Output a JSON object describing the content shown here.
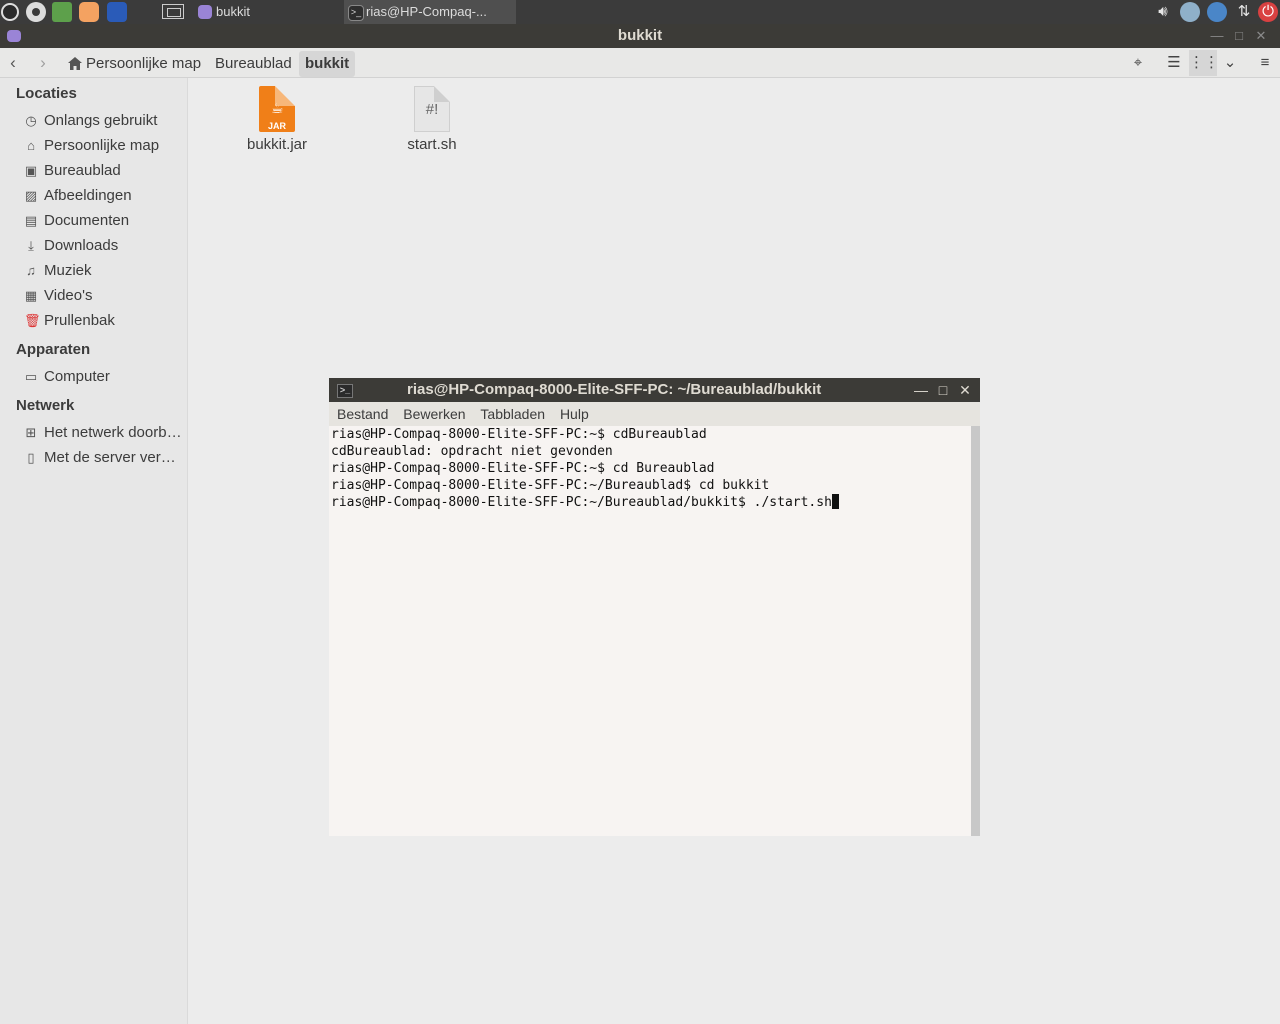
{
  "top_panel": {
    "tasks": [
      {
        "label": "bukkit"
      },
      {
        "label": "rias@HP-Compaq-..."
      }
    ]
  },
  "window": {
    "title": "bukkit"
  },
  "toolbar": {
    "breadcrumbs": [
      "Persoonlijke map",
      "Bureaublad",
      "bukkit"
    ]
  },
  "sidebar": {
    "sections": [
      {
        "heading": "Locaties",
        "items": [
          {
            "label": "Onlangs gebruikt",
            "icon": "clock-icon"
          },
          {
            "label": "Persoonlijke map",
            "icon": "home-icon"
          },
          {
            "label": "Bureaublad",
            "icon": "desktop-icon"
          },
          {
            "label": "Afbeeldingen",
            "icon": "image-icon"
          },
          {
            "label": "Documenten",
            "icon": "document-icon"
          },
          {
            "label": "Downloads",
            "icon": "download-icon"
          },
          {
            "label": "Muziek",
            "icon": "music-icon"
          },
          {
            "label": "Video's",
            "icon": "video-icon"
          },
          {
            "label": "Prullenbak",
            "icon": "trash-icon"
          }
        ]
      },
      {
        "heading": "Apparaten",
        "items": [
          {
            "label": "Computer",
            "icon": "computer-icon"
          }
        ]
      },
      {
        "heading": "Netwerk",
        "items": [
          {
            "label": "Het netwerk doorbladeren",
            "icon": "network-icon"
          },
          {
            "label": "Met de server verbinden",
            "icon": "server-icon"
          }
        ]
      }
    ]
  },
  "files": [
    {
      "name": "bukkit.jar",
      "icon": "jar-file-icon",
      "badge": "JAR"
    },
    {
      "name": "start.sh",
      "icon": "script-file-icon",
      "badge": "#!"
    }
  ],
  "terminal": {
    "title": "rias@HP-Compaq-8000-Elite-SFF-PC: ~/Bureaublad/bukkit",
    "menu": [
      "Bestand",
      "Bewerken",
      "Tabbladen",
      "Hulp"
    ],
    "lines": [
      "rias@HP-Compaq-8000-Elite-SFF-PC:~$ cdBureaublad",
      "cdBureaublad: opdracht niet gevonden",
      "rias@HP-Compaq-8000-Elite-SFF-PC:~$ cd Bureaublad",
      "rias@HP-Compaq-8000-Elite-SFF-PC:~/Bureaublad$ cd bukkit",
      "rias@HP-Compaq-8000-Elite-SFF-PC:~/Bureaublad/bukkit$ ./start.sh"
    ]
  },
  "colors": {
    "panel": "#3b3b3b",
    "titlebar": "#3c3b37",
    "jar_orange": "#f07f18",
    "trash_red": "#dd3333"
  }
}
